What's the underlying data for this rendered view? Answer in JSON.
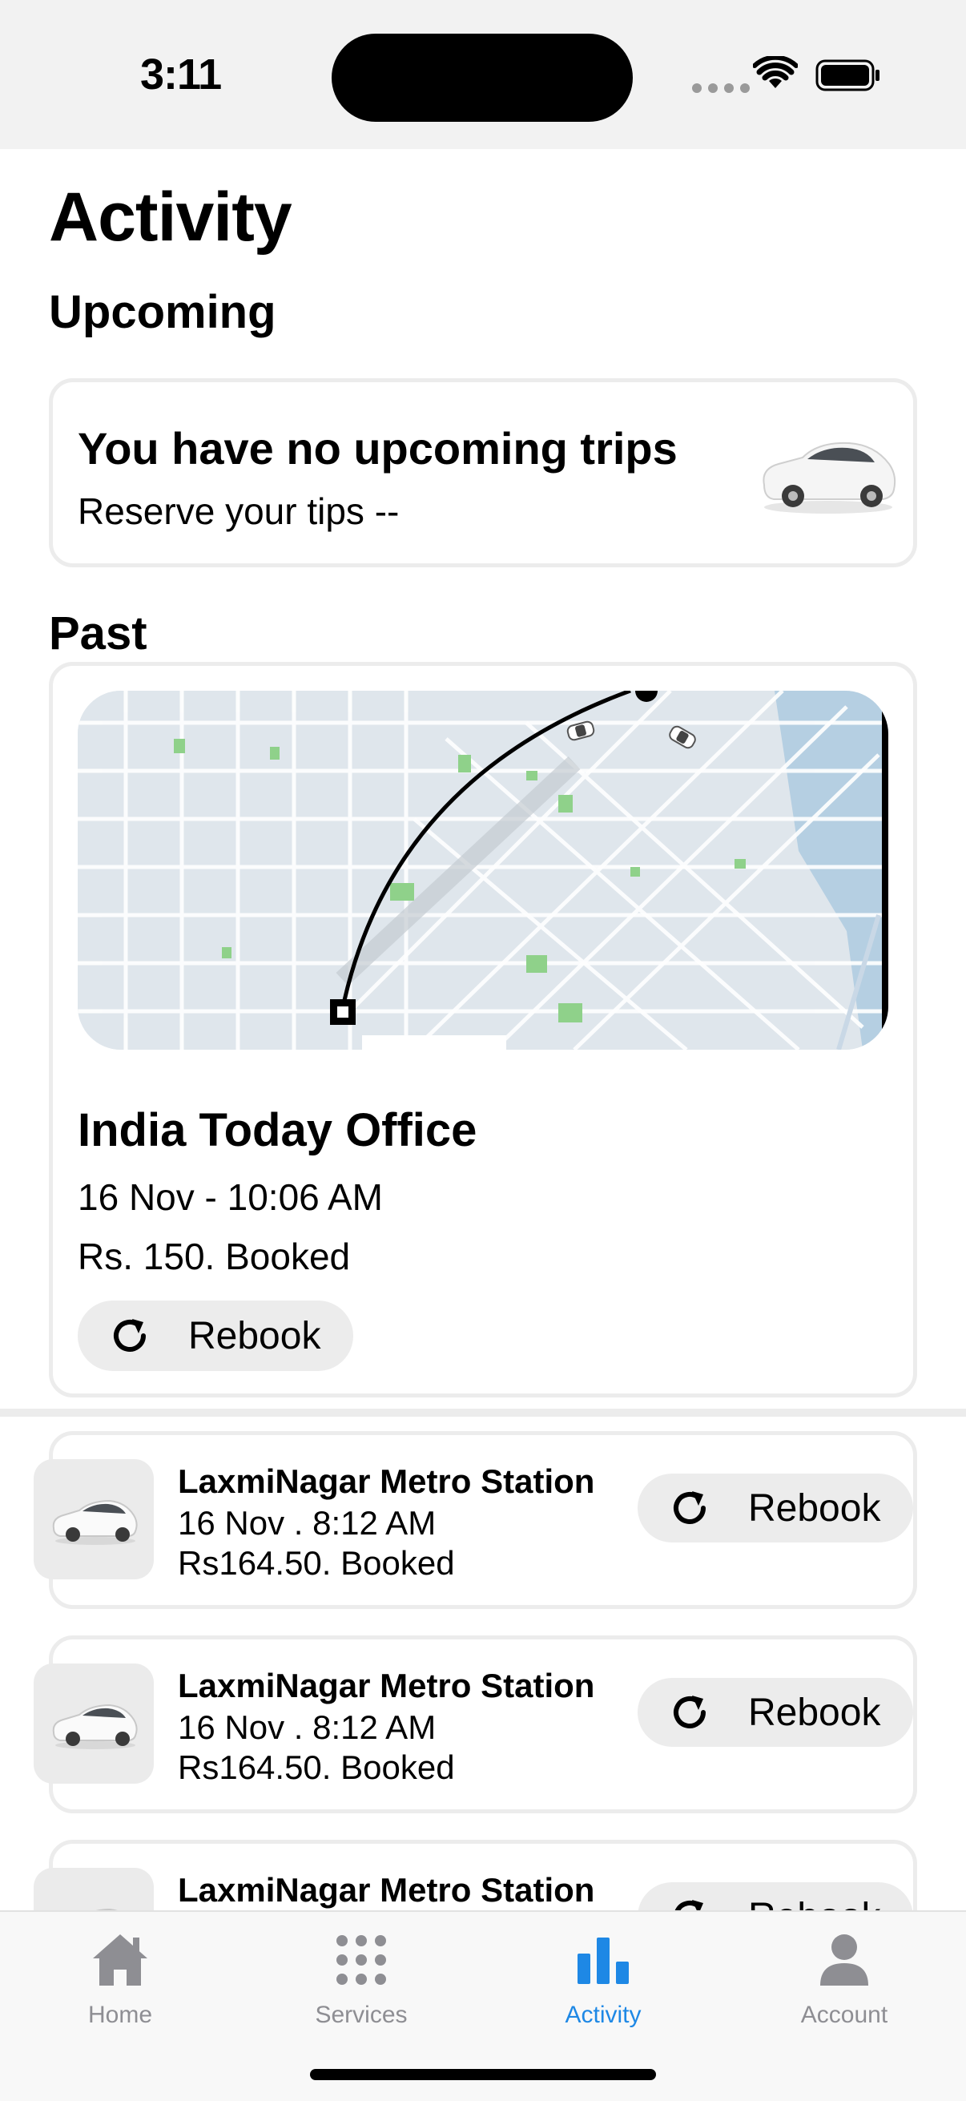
{
  "status_bar": {
    "time": "3:11"
  },
  "page": {
    "title": "Activity"
  },
  "upcoming": {
    "heading": "Upcoming",
    "title": "You have no upcoming trips",
    "subtitle": "Reserve your tips --"
  },
  "past": {
    "heading": "Past",
    "featured": {
      "destination": "India Today Office",
      "datetime": "16 Nov - 10:06 AM",
      "price_status": "Rs. 150. Booked",
      "rebook_label": "Rebook"
    },
    "items": [
      {
        "destination": "LaxmiNagar Metro Station",
        "datetime": "16 Nov . 8:12 AM",
        "price_status": "Rs164.50. Booked",
        "rebook_label": "Rebook"
      },
      {
        "destination": "LaxmiNagar Metro Station",
        "datetime": "16 Nov . 8:12 AM",
        "price_status": "Rs164.50. Booked",
        "rebook_label": "Rebook"
      },
      {
        "destination": "LaxmiNagar Metro Station",
        "datetime": "",
        "price_status": "",
        "rebook_label": "Rebook"
      }
    ]
  },
  "tab_bar": {
    "tabs": [
      {
        "label": "Home",
        "icon": "house-icon"
      },
      {
        "label": "Services",
        "icon": "grid-icon"
      },
      {
        "label": "Activity",
        "icon": "bar-chart-icon"
      },
      {
        "label": "Account",
        "icon": "person-icon"
      }
    ],
    "active_tab": "Activity"
  },
  "colors": {
    "accent": "#1e88e5",
    "tab_inactive": "#8e8e93",
    "card_border": "#ececec"
  }
}
